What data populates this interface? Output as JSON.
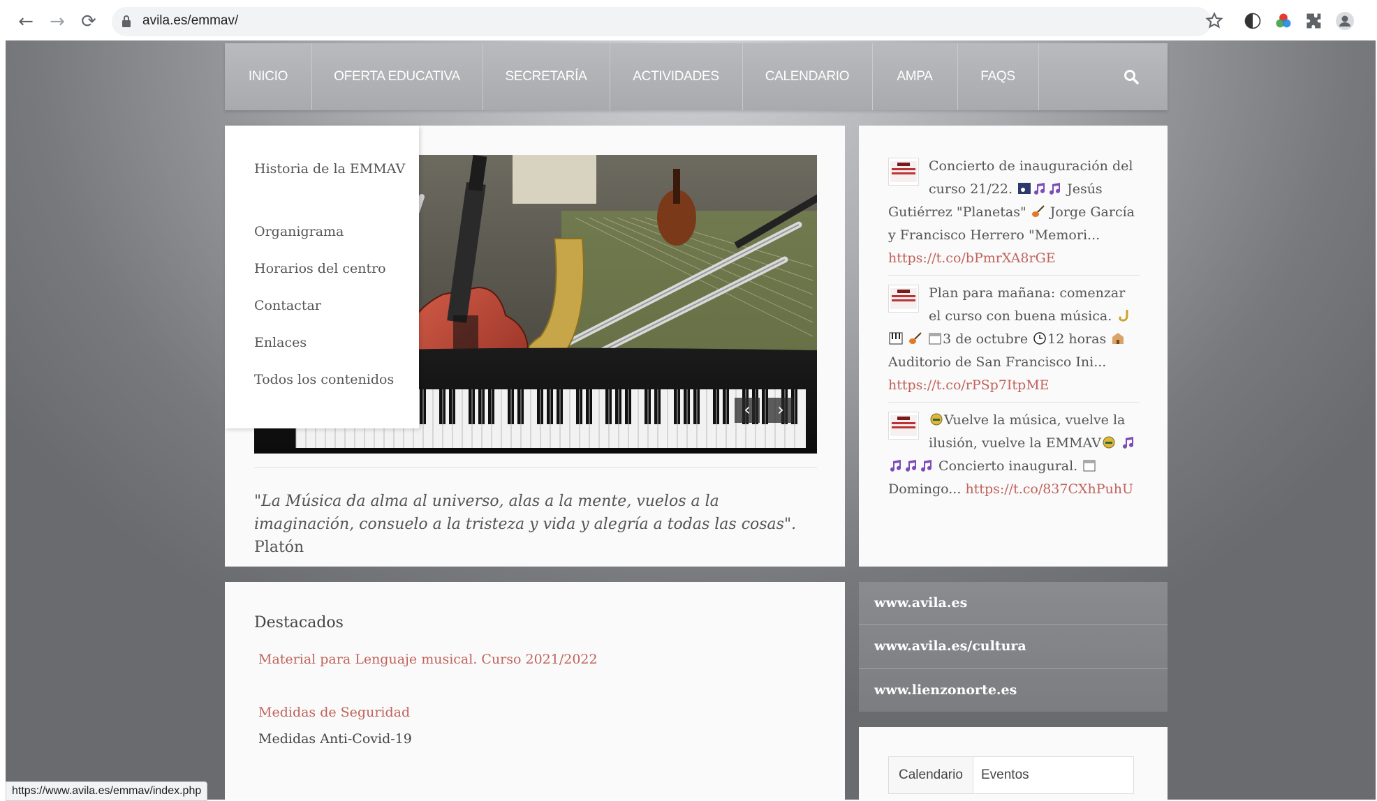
{
  "browser": {
    "url": "avila.es/emmav/",
    "status_url": "https://www.avila.es/emmav/index.php",
    "icons": [
      "back-icon",
      "forward-icon",
      "reload-icon",
      "lock-icon",
      "bookmark-star-icon",
      "dark-mode-icon",
      "color-extension-icon",
      "extensions-puzzle-icon",
      "profile-icon"
    ]
  },
  "menu": {
    "items": [
      "INICIO",
      "OFERTA EDUCATIVA",
      "SECRETARÍA",
      "ACTIVIDADES",
      "CALENDARIO",
      "AMPA",
      "FAQS"
    ]
  },
  "submenu": {
    "items": [
      "Historia de la EMMAV",
      "Organigrama",
      "Horarios del centro",
      "Contactar",
      "Enlaces",
      "Todos los contenidos"
    ]
  },
  "slider": {
    "prev": "‹",
    "next": "›"
  },
  "quote": {
    "text": "\"La Música da alma al universo, alas a la mente, vuelos a la imaginación, consuelo a la tristeza y vida y alegría a todas las cosas\".",
    "author": "Platón"
  },
  "tweets": [
    {
      "text_a": "Concierto de inauguración del curso 21/22.",
      "text_b": "Jesús Gutiérrez \"Planetas\"",
      "text_c": "Jorge García y Francisco Herrero \"Memori...",
      "link": "https://t.co/bPmrXA8rGE"
    },
    {
      "text_a": "Plan para mañana: comenzar el curso con buena música.",
      "text_b": "3 de octubre",
      "text_c": "12 horas",
      "text_d": "Auditorio de San Francisco Ini...",
      "link": "https://t.co/rPSp7ItpME"
    },
    {
      "text_a": "Vuelve la música, vuelve la ilusión, vuelve la EMMAV",
      "text_b": "Concierto inaugural.",
      "text_c": "Domingo...",
      "link": "https://t.co/837CXhPuhU"
    }
  ],
  "destacados": {
    "title": "Destacados",
    "link1": "Material para Lenguaje musical. Curso 2021/2022",
    "link2": "Medidas de Seguridad",
    "text2": "Medidas Anti-Covid-19"
  },
  "external_links": [
    "www.avila.es",
    "www.avila.es/cultura",
    "www.lienzonorte.es"
  ],
  "calendar": {
    "tabs": [
      "Calendario",
      "Eventos"
    ]
  },
  "colors": {
    "link": "#c0625a",
    "menubar": "#b0b1b4"
  }
}
